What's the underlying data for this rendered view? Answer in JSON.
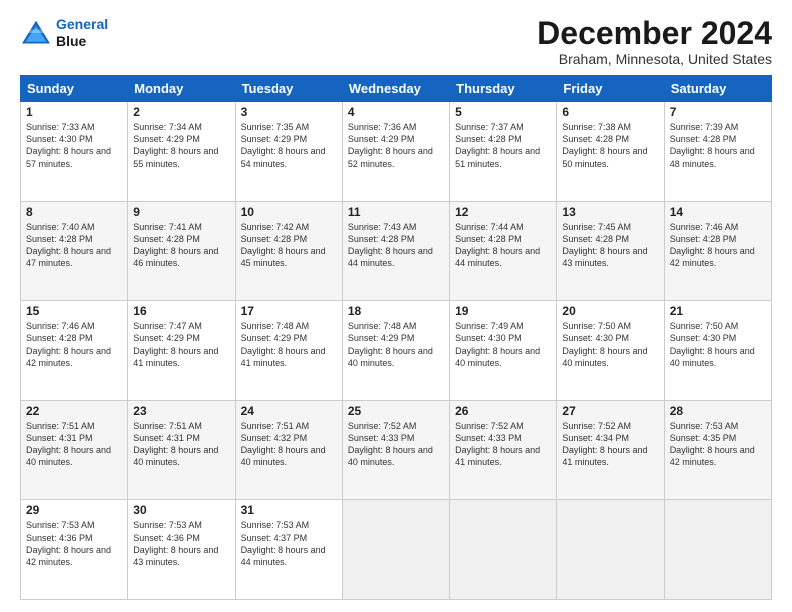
{
  "logo": {
    "line1": "General",
    "line2": "Blue"
  },
  "title": "December 2024",
  "subtitle": "Braham, Minnesota, United States",
  "days_header": [
    "Sunday",
    "Monday",
    "Tuesday",
    "Wednesday",
    "Thursday",
    "Friday",
    "Saturday"
  ],
  "weeks": [
    [
      {
        "day": "1",
        "sunrise": "7:33 AM",
        "sunset": "4:30 PM",
        "daylight": "8 hours and 57 minutes."
      },
      {
        "day": "2",
        "sunrise": "7:34 AM",
        "sunset": "4:29 PM",
        "daylight": "8 hours and 55 minutes."
      },
      {
        "day": "3",
        "sunrise": "7:35 AM",
        "sunset": "4:29 PM",
        "daylight": "8 hours and 54 minutes."
      },
      {
        "day": "4",
        "sunrise": "7:36 AM",
        "sunset": "4:29 PM",
        "daylight": "8 hours and 52 minutes."
      },
      {
        "day": "5",
        "sunrise": "7:37 AM",
        "sunset": "4:28 PM",
        "daylight": "8 hours and 51 minutes."
      },
      {
        "day": "6",
        "sunrise": "7:38 AM",
        "sunset": "4:28 PM",
        "daylight": "8 hours and 50 minutes."
      },
      {
        "day": "7",
        "sunrise": "7:39 AM",
        "sunset": "4:28 PM",
        "daylight": "8 hours and 48 minutes."
      }
    ],
    [
      {
        "day": "8",
        "sunrise": "7:40 AM",
        "sunset": "4:28 PM",
        "daylight": "8 hours and 47 minutes."
      },
      {
        "day": "9",
        "sunrise": "7:41 AM",
        "sunset": "4:28 PM",
        "daylight": "8 hours and 46 minutes."
      },
      {
        "day": "10",
        "sunrise": "7:42 AM",
        "sunset": "4:28 PM",
        "daylight": "8 hours and 45 minutes."
      },
      {
        "day": "11",
        "sunrise": "7:43 AM",
        "sunset": "4:28 PM",
        "daylight": "8 hours and 44 minutes."
      },
      {
        "day": "12",
        "sunrise": "7:44 AM",
        "sunset": "4:28 PM",
        "daylight": "8 hours and 44 minutes."
      },
      {
        "day": "13",
        "sunrise": "7:45 AM",
        "sunset": "4:28 PM",
        "daylight": "8 hours and 43 minutes."
      },
      {
        "day": "14",
        "sunrise": "7:46 AM",
        "sunset": "4:28 PM",
        "daylight": "8 hours and 42 minutes."
      }
    ],
    [
      {
        "day": "15",
        "sunrise": "7:46 AM",
        "sunset": "4:28 PM",
        "daylight": "8 hours and 42 minutes."
      },
      {
        "day": "16",
        "sunrise": "7:47 AM",
        "sunset": "4:29 PM",
        "daylight": "8 hours and 41 minutes."
      },
      {
        "day": "17",
        "sunrise": "7:48 AM",
        "sunset": "4:29 PM",
        "daylight": "8 hours and 41 minutes."
      },
      {
        "day": "18",
        "sunrise": "7:48 AM",
        "sunset": "4:29 PM",
        "daylight": "8 hours and 40 minutes."
      },
      {
        "day": "19",
        "sunrise": "7:49 AM",
        "sunset": "4:30 PM",
        "daylight": "8 hours and 40 minutes."
      },
      {
        "day": "20",
        "sunrise": "7:50 AM",
        "sunset": "4:30 PM",
        "daylight": "8 hours and 40 minutes."
      },
      {
        "day": "21",
        "sunrise": "7:50 AM",
        "sunset": "4:30 PM",
        "daylight": "8 hours and 40 minutes."
      }
    ],
    [
      {
        "day": "22",
        "sunrise": "7:51 AM",
        "sunset": "4:31 PM",
        "daylight": "8 hours and 40 minutes."
      },
      {
        "day": "23",
        "sunrise": "7:51 AM",
        "sunset": "4:31 PM",
        "daylight": "8 hours and 40 minutes."
      },
      {
        "day": "24",
        "sunrise": "7:51 AM",
        "sunset": "4:32 PM",
        "daylight": "8 hours and 40 minutes."
      },
      {
        "day": "25",
        "sunrise": "7:52 AM",
        "sunset": "4:33 PM",
        "daylight": "8 hours and 40 minutes."
      },
      {
        "day": "26",
        "sunrise": "7:52 AM",
        "sunset": "4:33 PM",
        "daylight": "8 hours and 41 minutes."
      },
      {
        "day": "27",
        "sunrise": "7:52 AM",
        "sunset": "4:34 PM",
        "daylight": "8 hours and 41 minutes."
      },
      {
        "day": "28",
        "sunrise": "7:53 AM",
        "sunset": "4:35 PM",
        "daylight": "8 hours and 42 minutes."
      }
    ],
    [
      {
        "day": "29",
        "sunrise": "7:53 AM",
        "sunset": "4:36 PM",
        "daylight": "8 hours and 42 minutes."
      },
      {
        "day": "30",
        "sunrise": "7:53 AM",
        "sunset": "4:36 PM",
        "daylight": "8 hours and 43 minutes."
      },
      {
        "day": "31",
        "sunrise": "7:53 AM",
        "sunset": "4:37 PM",
        "daylight": "8 hours and 44 minutes."
      },
      null,
      null,
      null,
      null
    ]
  ],
  "labels": {
    "sunrise": "Sunrise:",
    "sunset": "Sunset:",
    "daylight": "Daylight:"
  }
}
